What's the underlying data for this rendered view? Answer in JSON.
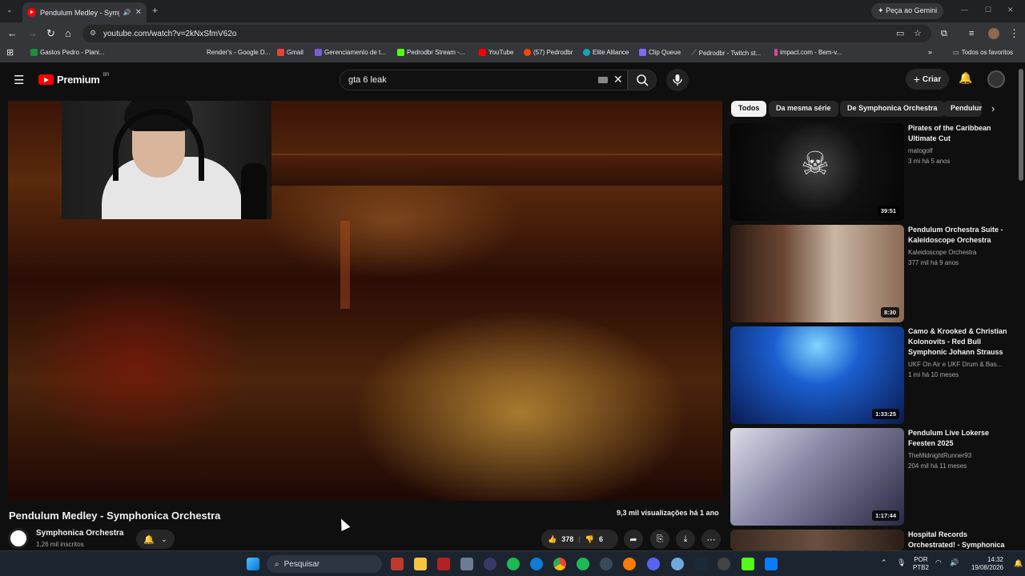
{
  "browser": {
    "tab_title": "Pendulum Medley - Symph",
    "gemini_label": "Peça ao Gemini",
    "url": "youtube.com/watch?v=2kNxSfmV62o",
    "bookmarks": [
      "Gastos Pedro - Plani...",
      "Render's - Google D...",
      "Gmail",
      "Gerenciamento de t...",
      "Pedrodbr Stream -...",
      "YouTube",
      "(57) Pedrodbr",
      "Elite Alliance",
      "Clip Queue",
      "Pedrodbr - Twitch st...",
      "impact.com - Bem-v..."
    ],
    "all_bookmarks": "Todos os favoritos"
  },
  "youtube": {
    "logo_text": "Premium",
    "region": "BR",
    "search_value": "gta 6 leak",
    "create_label": "Criar"
  },
  "video": {
    "title": "Pendulum Medley - Symphonica Orchestra",
    "stats": "9,3 mil visualizações  há 1 ano",
    "channel": "Symphonica Orchestra",
    "subscribers": "1,26 mil inscritos",
    "likes": "378",
    "dislikes": "6"
  },
  "chips": [
    "Todos",
    "Da mesma série",
    "De Symphonica Orchestra",
    "Pendulum"
  ],
  "related": [
    {
      "title": "Pirates of the Caribbean Ultimate Cut",
      "channel": "matogolf",
      "meta": "3 mi  há 5 anos",
      "duration": "39:51"
    },
    {
      "title": "Pendulum Orchestra Suite - Kaleidoscope Orchestra",
      "channel": "Kaleidoscope Orchestra",
      "meta": "377 mil  há 9 anos",
      "duration": "8:30"
    },
    {
      "title": "Camo & Krooked & Christian Kolonovits - Red Bull Symphonic Johann Strauss ...",
      "channel": "UKF On Air e UKF Drum & Bas...",
      "meta": "1 mi  há 10 meses",
      "duration": "1:33:25"
    },
    {
      "title": "Pendulum Live Lokerse Feesten 2025",
      "channel": "TheMidnightRunner93",
      "meta": "204 mil  há 11 meses",
      "duration": "1:17:44"
    },
    {
      "title": "Hospital Records Orchestrated! - Symphonica",
      "channel": "",
      "meta": "",
      "duration": ""
    }
  ],
  "taskbar": {
    "search_placeholder": "Pesquisar",
    "lang": "POR",
    "layout": "PTB2",
    "time": "14:32",
    "date": "19/08/2026"
  },
  "colors": {
    "bg": "#0f0f0f",
    "accent": "#ff0000",
    "chip_active": "#f1f1f1"
  }
}
